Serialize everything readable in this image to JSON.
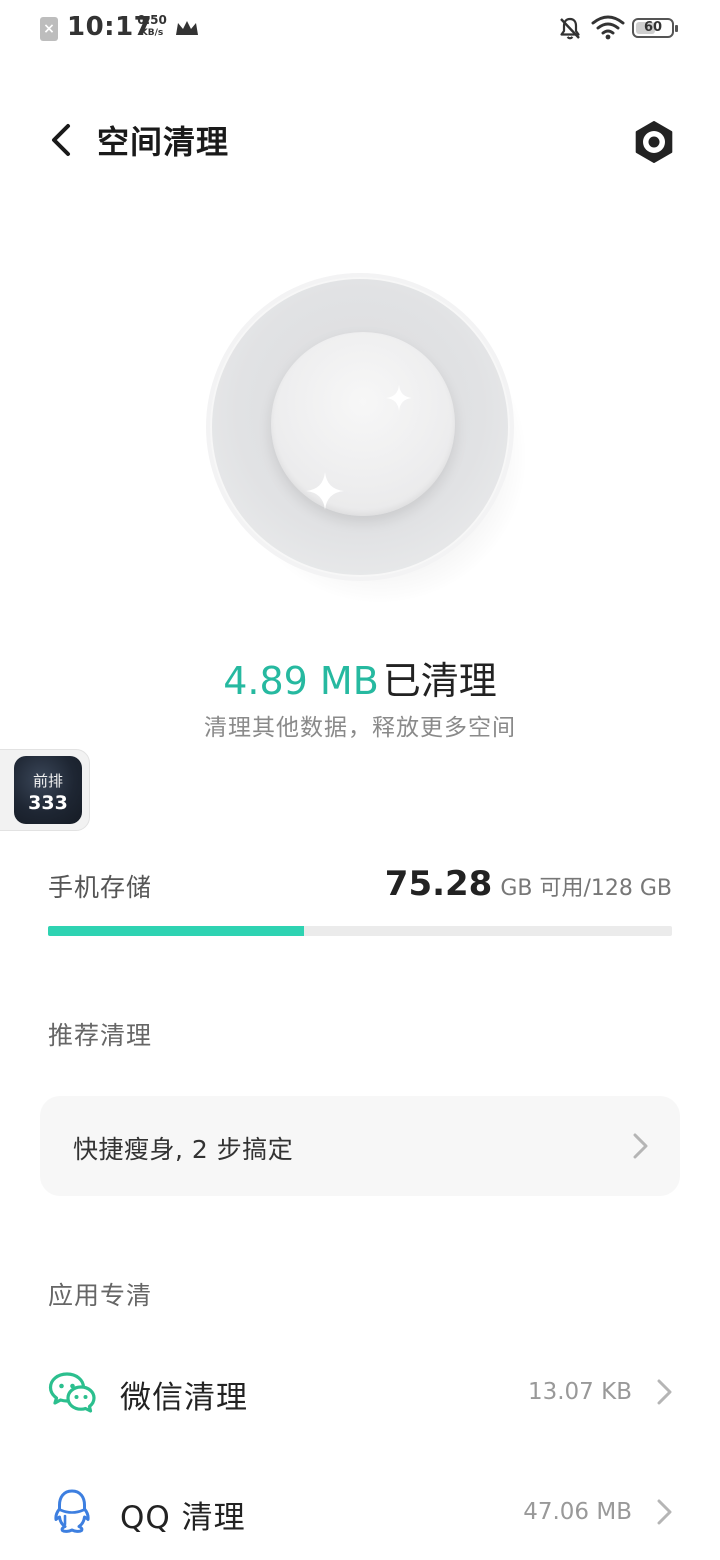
{
  "status_bar": {
    "time": "10:17",
    "net_speed_value": "0.50",
    "net_speed_unit": "KB/s",
    "battery_level": "60",
    "battery_fraction": 0.6,
    "sim_status": "no-sim",
    "icons": [
      "no-sim-icon",
      "crown-icon",
      "bell-off-icon",
      "wifi-icon",
      "battery-icon"
    ]
  },
  "header": {
    "title": "空间清理",
    "back_icon": "chevron-left-icon",
    "settings_icon": "settings-hex-icon"
  },
  "result": {
    "amount": "4.89 MB",
    "label": "已清理",
    "subtitle": "清理其他数据，释放更多空间",
    "accent_color": "#26b9a0"
  },
  "float_badge": {
    "top_text": "前排",
    "number": "333"
  },
  "storage": {
    "label": "手机存储",
    "available": "75.28",
    "suffix": "GB 可用/128 GB",
    "used_fraction": 0.41,
    "bar_color": "#2ed3b2"
  },
  "recommended": {
    "section_title": "推荐清理",
    "card_text": "快捷瘦身, 2 步搞定"
  },
  "apps": {
    "section_title": "应用专清",
    "items": [
      {
        "name": "微信清理",
        "size": "13.07 KB",
        "icon": "wechat-icon",
        "color": "#2bbf8e"
      },
      {
        "name": "QQ 清理",
        "size": "47.06 MB",
        "icon": "qq-icon",
        "color": "#3d7fe0"
      }
    ]
  }
}
